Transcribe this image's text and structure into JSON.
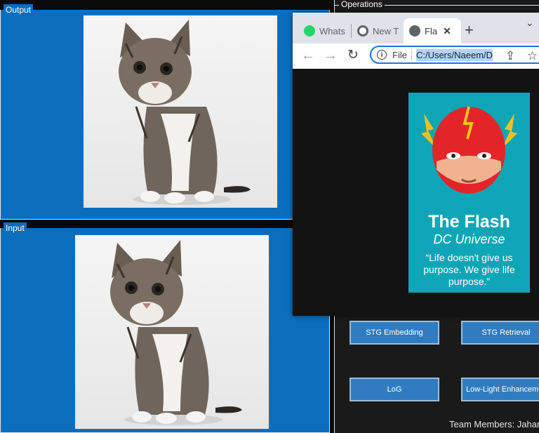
{
  "panels": {
    "output_label": "Output",
    "input_label": "Input",
    "operations_label": "Operations"
  },
  "operations": {
    "buttons": [
      "STG Embedding",
      "STG Retrieval",
      "LoG",
      "Low-Light Enhancement"
    ],
    "team_text": "Team Members: Jahan"
  },
  "browser": {
    "tabs": [
      {
        "title": "Whats",
        "icon": "whatsapp-icon"
      },
      {
        "title": "New T",
        "icon": "chrome-icon"
      },
      {
        "title": "Fla",
        "icon": "globe-icon"
      }
    ],
    "address_scheme": "File",
    "address_url": "C:/Users/Naeem/D",
    "poster": {
      "title": "The Flash",
      "subtitle": "DC Universe",
      "quote": "“Life doesn't give us purpose. We give life purpose.”"
    }
  },
  "colors": {
    "panel_blue": "#0a6ebd",
    "button_blue": "#2f7dc0",
    "poster_teal": "#0ea6b6",
    "flash_red": "#e3252a"
  }
}
